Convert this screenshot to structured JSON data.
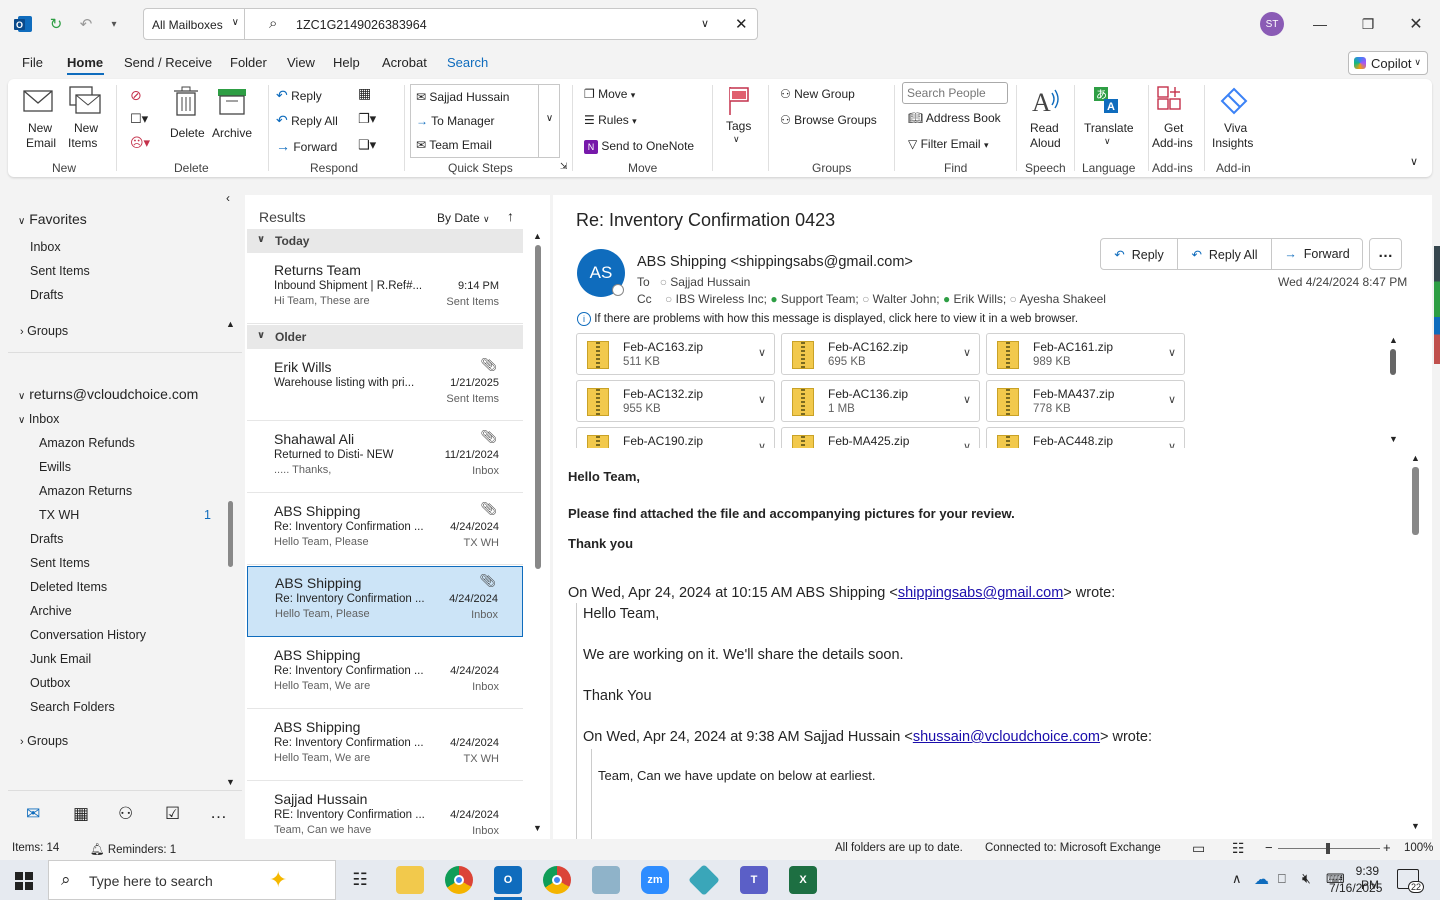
{
  "titlebar": {
    "mailbox_scope": "All Mailboxes",
    "search_query": "1ZC1G2149026383964",
    "avatar_initials": "ST"
  },
  "menu": [
    "File",
    "Home",
    "Send / Receive",
    "Folder",
    "View",
    "Help",
    "Acrobat",
    "Search"
  ],
  "copilot_label": "Copilot",
  "ribbon": {
    "new_email": [
      "New",
      "Email"
    ],
    "new_items": [
      "New",
      "Items"
    ],
    "delete": "Delete",
    "archive": "Archive",
    "reply": "Reply",
    "reply_all": "Reply All",
    "forward": "Forward",
    "qs": [
      "Sajjad Hussain",
      "To Manager",
      "Team Email"
    ],
    "move": "Move",
    "rules": "Rules",
    "onenote": "Send to OneNote",
    "tags": "Tags",
    "new_group": "New Group",
    "browse_groups": "Browse Groups",
    "search_people_placeholder": "Search People",
    "address_book": "Address Book",
    "filter_email": "Filter Email",
    "read_aloud": [
      "Read",
      "Aloud"
    ],
    "translate": "Translate",
    "get_addins": [
      "Get",
      "Add-ins"
    ],
    "viva": [
      "Viva",
      "Insights"
    ],
    "groups_labels": [
      "New",
      "Delete",
      "Respond",
      "Quick Steps",
      "Move",
      "Groups",
      "Find",
      "Speech",
      "Language",
      "Add-ins",
      "Add-in"
    ]
  },
  "nav": {
    "favorites": "Favorites",
    "fav_items": [
      "Inbox",
      "Sent Items",
      "Drafts"
    ],
    "groups": "Groups",
    "account": "returns@vcloudchoice.com",
    "inbox": "Inbox",
    "subfolders": [
      "Amazon Refunds",
      "Ewills",
      "Amazon Returns",
      "TX WH"
    ],
    "txwh_count": "1",
    "folders": [
      "Drafts",
      "Sent Items",
      "Deleted Items",
      "Archive",
      "Conversation History",
      "Junk Email",
      "Outbox",
      "Search Folders"
    ],
    "groups2": "Groups"
  },
  "list": {
    "header": "Results",
    "sort": "By Date",
    "group_today": "Today",
    "group_older": "Older",
    "items": [
      {
        "from": "Returns Team",
        "subject": "Inbound Shipment | R.Ref#...",
        "preview": "Hi Team,  These are",
        "date": "9:14 PM",
        "folder": "Sent Items",
        "clip": false
      },
      {
        "from": "Erik Wills",
        "subject": "Warehouse listing with pri...",
        "preview": "",
        "date": "1/21/2025",
        "folder": "Sent Items",
        "clip": true
      },
      {
        "from": "Shahawal Ali",
        "subject": "Returned to Disti- NEW",
        "preview": "..... Thanks,",
        "date": "11/21/2024",
        "folder": "Inbox",
        "clip": true
      },
      {
        "from": "ABS Shipping",
        "subject": "Re: Inventory Confirmation ...",
        "preview": "Hello Team,  Please",
        "date": "4/24/2024",
        "folder": "TX WH",
        "clip": true
      },
      {
        "from": "ABS Shipping",
        "subject": "Re: Inventory Confirmation ...",
        "preview": "Hello Team,  Please",
        "date": "4/24/2024",
        "folder": "Inbox",
        "clip": true
      },
      {
        "from": "ABS Shipping",
        "subject": "Re: Inventory Confirmation ...",
        "preview": "Hello Team,  We are",
        "date": "4/24/2024",
        "folder": "Inbox",
        "clip": false
      },
      {
        "from": "ABS Shipping",
        "subject": "Re: Inventory Confirmation ...",
        "preview": "Hello Team,  We are",
        "date": "4/24/2024",
        "folder": "TX WH",
        "clip": false
      },
      {
        "from": "Sajjad Hussain",
        "subject": "RE: Inventory Confirmation ...",
        "preview": "Team, Can we have",
        "date": "4/24/2024",
        "folder": "Inbox",
        "clip": false
      }
    ]
  },
  "message": {
    "subject": "Re: Inventory Confirmation 0423",
    "sender_initials": "AS",
    "sender": "ABS Shipping <shippingsabs@gmail.com>",
    "to_label": "To",
    "to": "Sajjad Hussain",
    "cc_label": "Cc",
    "cc": [
      "IBS Wireless Inc;",
      "Support Team;",
      "Walter John;",
      "Erik Wills;",
      "Ayesha Shakeel"
    ],
    "date": "Wed 4/24/2024 8:47 PM",
    "reply": "Reply",
    "reply_all": "Reply All",
    "forward": "Forward",
    "info": "If there are problems with how this message is displayed, click here to view it in a web browser.",
    "attachments": [
      {
        "name": "Feb-AC163.zip",
        "size": "511 KB"
      },
      {
        "name": "Feb-AC162.zip",
        "size": "695 KB"
      },
      {
        "name": "Feb-AC161.zip",
        "size": "989 KB"
      },
      {
        "name": "Feb-AC132.zip",
        "size": "955 KB"
      },
      {
        "name": "Feb-AC136.zip",
        "size": "1 MB"
      },
      {
        "name": "Feb-MA437.zip",
        "size": "778 KB"
      },
      {
        "name": "Feb-AC190.zip",
        "size": ""
      },
      {
        "name": "Feb-MA425.zip",
        "size": ""
      },
      {
        "name": "Feb-AC448.zip",
        "size": ""
      }
    ],
    "body1": "Hello Team,",
    "body2": "Please find attached the file and accompanying pictures for your review.",
    "body3": "Thank you",
    "q1_pre": "On Wed, Apr 24, 2024 at 10:15 AM ABS Shipping <",
    "q1_link": "shippingsabs@gmail.com",
    "q1_post": "> wrote:",
    "q1_l1": "Hello Team,",
    "q1_l2": "We are working on it. We'll share the details soon.",
    "q1_l3": "Thank You",
    "q2_pre": "On Wed, Apr 24, 2024 at 9:38 AM Sajjad Hussain <",
    "q2_link": "shussain@vcloudchoice.com",
    "q2_post": "> wrote:",
    "q2_l1": "Team, Can we have update on below at earliest."
  },
  "status": {
    "items": "Items: 14",
    "reminders": "Reminders: 1",
    "sync": "All folders are up to date.",
    "connected": "Connected to: Microsoft Exchange",
    "zoom": "100%"
  },
  "taskbar": {
    "search_placeholder": "Type here to search",
    "time": "9:39 PM",
    "date": "7/16/2025",
    "notif": "22"
  }
}
